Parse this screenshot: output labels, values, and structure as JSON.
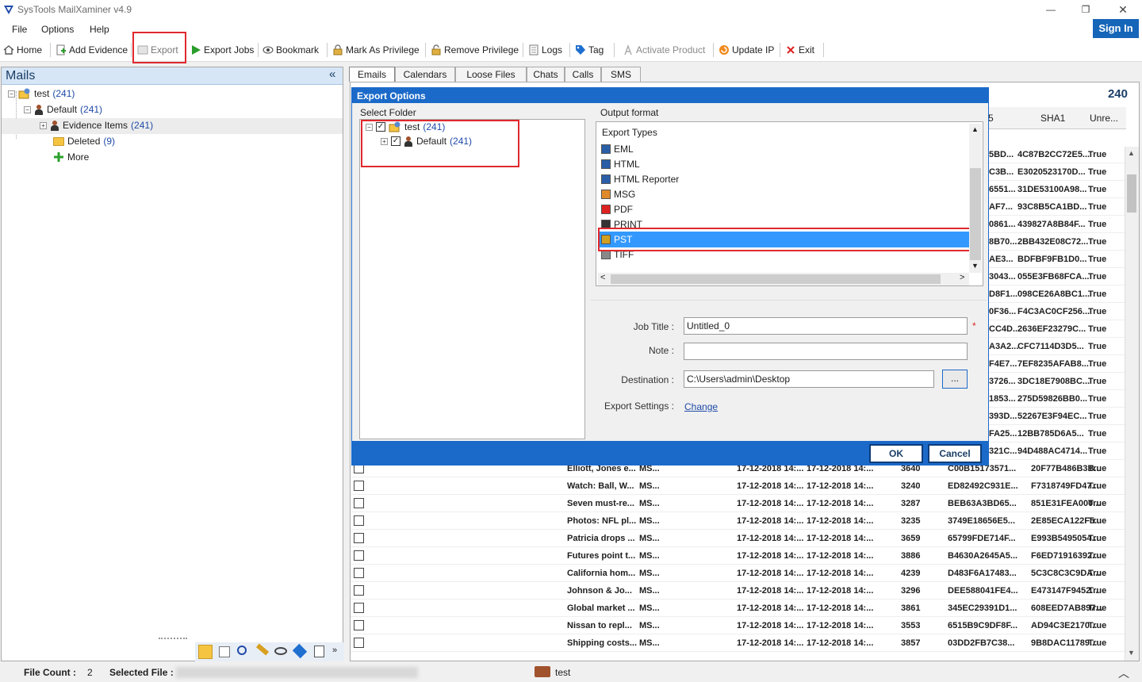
{
  "window": {
    "title": "SysTools MailXaminer v4.9"
  },
  "menu": {
    "items": [
      "File",
      "Options",
      "Help"
    ],
    "signin": "Sign In"
  },
  "toolbar": {
    "home": "Home",
    "add_evidence": "Add Evidence",
    "export": "Export",
    "export_jobs": "Export Jobs",
    "bookmark": "Bookmark",
    "mark_privilege": "Mark As Privilege",
    "remove_privilege": "Remove Privilege",
    "logs": "Logs",
    "tag": "Tag",
    "activate": "Activate Product",
    "update_ip": "Update IP",
    "exit": "Exit"
  },
  "left": {
    "title": "Mails",
    "collapse": "«",
    "tree": {
      "root_label": "test",
      "root_count": "(241)",
      "default_label": "Default",
      "default_count": "(241)",
      "evidence_label": "Evidence Items",
      "evidence_count": "(241)",
      "deleted_label": "Deleted",
      "deleted_count": "(9)",
      "more_label": "More"
    }
  },
  "tabs": [
    "Emails",
    "Calendars",
    "Loose Files",
    "Chats",
    "Calls",
    "SMS"
  ],
  "grid": {
    "count": "240",
    "headers": {
      "md5_fragment": "5",
      "sha1": "SHA1",
      "unread": "Unre..."
    },
    "top_rows": [
      {
        "md5": "5BD...",
        "sha1": "4C87B2CC72E5...",
        "unread": "True"
      },
      {
        "md5": "C3B...",
        "sha1": "E3020523170D...",
        "unread": "True"
      },
      {
        "md5": "6551...",
        "sha1": "31DE53100A98...",
        "unread": "True"
      },
      {
        "md5": "AF7...",
        "sha1": "93C8B5CA1BD...",
        "unread": "True"
      },
      {
        "md5": "0861...",
        "sha1": "439827A8B84F...",
        "unread": "True"
      },
      {
        "md5": "8B70...",
        "sha1": "2BB432E08C72...",
        "unread": "True"
      },
      {
        "md5": "AE3...",
        "sha1": "BDFBF9FB1D0...",
        "unread": "True"
      },
      {
        "md5": "3043...",
        "sha1": "055E3FB68FCA...",
        "unread": "True"
      },
      {
        "md5": "D8F1...",
        "sha1": "098CE26A8BC1...",
        "unread": "True"
      },
      {
        "md5": "0F36...",
        "sha1": "F4C3AC0CF256...",
        "unread": "True"
      },
      {
        "md5": "CC4D...",
        "sha1": "2636EF23279C...",
        "unread": "True"
      },
      {
        "md5": "A3A2...",
        "sha1": "CFC7114D3D5...",
        "unread": "True"
      },
      {
        "md5": "F4E7...",
        "sha1": "7EF8235AFAB8...",
        "unread": "True"
      },
      {
        "md5": "3726...",
        "sha1": "3DC18E7908BC...",
        "unread": "True"
      },
      {
        "md5": "1853...",
        "sha1": "275D59826BB0...",
        "unread": "True"
      },
      {
        "md5": "393D...",
        "sha1": "52267E3F94EC...",
        "unread": "True"
      },
      {
        "md5": "FA25...",
        "sha1": "12BB785D6A5...",
        "unread": "True"
      },
      {
        "md5": "321C...",
        "sha1": "94D488AC4714...",
        "unread": "True"
      }
    ],
    "rows": [
      {
        "subject": "Elliott, Jones e...",
        "from": "MS...",
        "sent": "17-12-2018 14:...",
        "recv": "17-12-2018 14:...",
        "size": "3640",
        "md5": "C00B15173571...",
        "sha1": "20F77B486B3B...",
        "unread": "True"
      },
      {
        "subject": "Watch: Ball, W...",
        "from": "MS...",
        "sent": "17-12-2018 14:...",
        "recv": "17-12-2018 14:...",
        "size": "3240",
        "md5": "ED82492C931E...",
        "sha1": "F7318749FD47...",
        "unread": "True"
      },
      {
        "subject": "Seven must-re...",
        "from": "MS...",
        "sent": "17-12-2018 14:...",
        "recv": "17-12-2018 14:...",
        "size": "3287",
        "md5": "BEB63A3BD65...",
        "sha1": "851E31FEA000...",
        "unread": "True"
      },
      {
        "subject": "Photos: NFL pl...",
        "from": "MS...",
        "sent": "17-12-2018 14:...",
        "recv": "17-12-2018 14:...",
        "size": "3235",
        "md5": "3749E18656E5...",
        "sha1": "2E85ECA122F5...",
        "unread": "True"
      },
      {
        "subject": "Patricia drops ...",
        "from": "MS...",
        "sent": "17-12-2018 14:...",
        "recv": "17-12-2018 14:...",
        "size": "3659",
        "md5": "65799FDE714F...",
        "sha1": "E993B5495054...",
        "unread": "True"
      },
      {
        "subject": "Futures point t...",
        "from": "MS...",
        "sent": "17-12-2018 14:...",
        "recv": "17-12-2018 14:...",
        "size": "3886",
        "md5": "B4630A2645A5...",
        "sha1": "F6ED71916392...",
        "unread": "True"
      },
      {
        "subject": "California hom...",
        "from": "MS...",
        "sent": "17-12-2018 14:...",
        "recv": "17-12-2018 14:...",
        "size": "4239",
        "md5": "D483F6A17483...",
        "sha1": "5C3C8C3C9DA...",
        "unread": "True"
      },
      {
        "subject": "Johnson & Jo...",
        "from": "MS...",
        "sent": "17-12-2018 14:...",
        "recv": "17-12-2018 14:...",
        "size": "3296",
        "md5": "DEE588041FE4...",
        "sha1": "E473147F9452...",
        "unread": "True"
      },
      {
        "subject": "Global market ...",
        "from": "MS...",
        "sent": "17-12-2018 14:...",
        "recv": "17-12-2018 14:...",
        "size": "3861",
        "md5": "345EC29391D1...",
        "sha1": "608EED7AB897...",
        "unread": "True"
      },
      {
        "subject": "Nissan to repl...",
        "from": "MS...",
        "sent": "17-12-2018 14:...",
        "recv": "17-12-2018 14:...",
        "size": "3553",
        "md5": "6515B9C9DF8F...",
        "sha1": "AD94C3E2170...",
        "unread": "True"
      },
      {
        "subject": "Shipping costs...",
        "from": "MS...",
        "sent": "17-12-2018 14:...",
        "recv": "17-12-2018 14:...",
        "size": "3857",
        "md5": "03DD2FB7C38...",
        "sha1": "9B8DAC11789...",
        "unread": "True"
      }
    ]
  },
  "dialog": {
    "title": "Export Options",
    "select_folder": "Select Folder",
    "output_format": "Output format",
    "folder_root": "test",
    "folder_root_count": "(241)",
    "folder_default": "Default",
    "folder_default_count": "(241)",
    "export_types_label": "Export Types",
    "formats": [
      "EML",
      "HTML",
      "HTML Reporter",
      "MSG",
      "PDF",
      "PRINT",
      "PST",
      "TIFF"
    ],
    "selected_format": "PST",
    "job_title_label": "Job Title :",
    "job_title_value": "Untitled_0",
    "required_mark": "*",
    "note_label": "Note :",
    "note_value": "",
    "destination_label": "Destination :",
    "destination_value": "C:\\Users\\admin\\Desktop",
    "browse": "...",
    "export_settings_label": "Export Settings :",
    "change_link": "Change",
    "ok": "OK",
    "cancel": "Cancel"
  },
  "status": {
    "file_count_label": "File Count :",
    "file_count_value": "2",
    "selected_file_label": "Selected File :",
    "case_name": "test"
  },
  "colors": {
    "accent": "#1b6ac9",
    "highlight_box": "#e0282e",
    "selection": "#3399ff"
  }
}
